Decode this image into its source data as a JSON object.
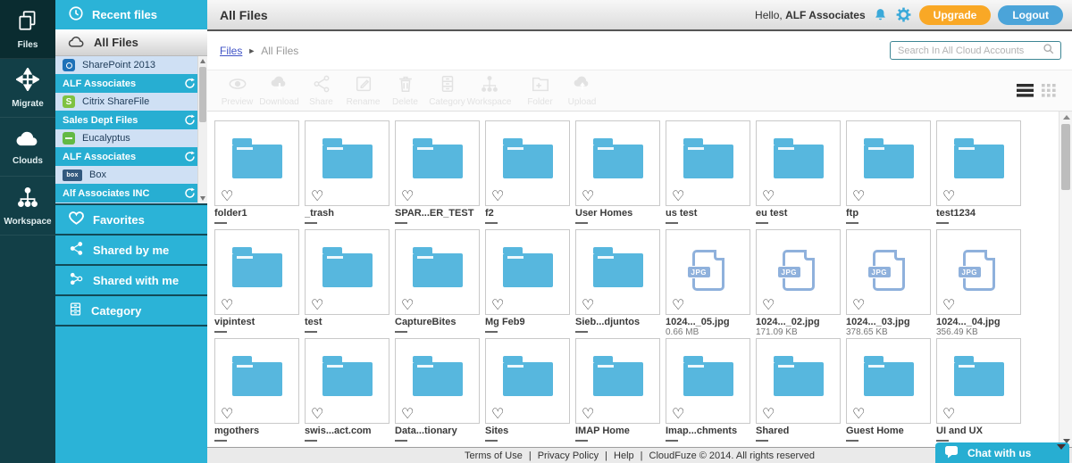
{
  "colors": {
    "teal": "#2bb3d7",
    "rail_dark": "#123f47",
    "rail_active": "#0a2c30",
    "account_row": "#27aed2",
    "provider_row": "#cfe0f4",
    "orange_button": "#f9a826",
    "blue_button": "#4ba4d9",
    "folder_icon": "#57b7de",
    "jpg_icon": "#8fb1dc",
    "header_icon_blue": "#3aa9d9"
  },
  "rail": {
    "items": [
      {
        "label": "Files",
        "icon": "files-icon",
        "active": true
      },
      {
        "label": "Migrate",
        "icon": "migrate-icon",
        "active": false
      },
      {
        "label": "Clouds",
        "icon": "clouds-icon",
        "active": false
      },
      {
        "label": "Workspace",
        "icon": "workspace-icon",
        "active": false
      }
    ]
  },
  "sidebar": {
    "recent_files": "Recent files",
    "all_files": "All Files",
    "accounts": [
      {
        "provider": "SharePoint 2013",
        "account": "ALF Associates"
      },
      {
        "provider": "Citrix ShareFile",
        "account": "Sales Dept Files"
      },
      {
        "provider": "Eucalyptus",
        "account": "ALF Associates"
      },
      {
        "provider": "Box",
        "account": "Alf Associates INC"
      }
    ],
    "favorites": "Favorites",
    "shared_by_me": "Shared by me",
    "shared_with_me": "Shared with me",
    "category": "Category"
  },
  "header": {
    "title": "All Files",
    "greeting": "Hello,",
    "username": "ALF Associates",
    "upgrade_label": "Upgrade",
    "logout_label": "Logout"
  },
  "breadcrumb": {
    "root": "Files",
    "current": "All Files"
  },
  "search": {
    "placeholder": "Search In All Cloud Accounts"
  },
  "toolbar": {
    "buttons": [
      {
        "label": "Preview"
      },
      {
        "label": "Download"
      },
      {
        "label": "Share"
      },
      {
        "label": "Rename"
      },
      {
        "label": "Delete"
      },
      {
        "label": "Category"
      },
      {
        "label": "Workspace"
      },
      {
        "label": "Folder"
      },
      {
        "label": "Upload"
      }
    ]
  },
  "grid": {
    "items": [
      {
        "name": "folder1",
        "type": "folder"
      },
      {
        "name": "_trash",
        "type": "folder"
      },
      {
        "name": "SPAR...ER_TEST",
        "type": "folder"
      },
      {
        "name": "f2",
        "type": "folder"
      },
      {
        "name": "User Homes",
        "type": "folder"
      },
      {
        "name": "us test",
        "type": "folder"
      },
      {
        "name": "eu test",
        "type": "folder"
      },
      {
        "name": "ftp",
        "type": "folder"
      },
      {
        "name": "test1234",
        "type": "folder"
      },
      {
        "name": "vipintest",
        "type": "folder"
      },
      {
        "name": "test",
        "type": "folder"
      },
      {
        "name": "CaptureBites",
        "type": "folder"
      },
      {
        "name": "Mg Feb9",
        "type": "folder"
      },
      {
        "name": "Sieb...djuntos",
        "type": "folder"
      },
      {
        "name": "1024..._05.jpg",
        "type": "jpg",
        "size": "0.66 MB"
      },
      {
        "name": "1024..._02.jpg",
        "type": "jpg",
        "size": "171.09 KB"
      },
      {
        "name": "1024..._03.jpg",
        "type": "jpg",
        "size": "378.65 KB"
      },
      {
        "name": "1024..._04.jpg",
        "type": "jpg",
        "size": "356.49 KB"
      },
      {
        "name": "mgothers",
        "type": "folder"
      },
      {
        "name": "swis...act.com",
        "type": "folder"
      },
      {
        "name": "Data...tionary",
        "type": "folder"
      },
      {
        "name": "Sites",
        "type": "folder"
      },
      {
        "name": "IMAP Home",
        "type": "folder"
      },
      {
        "name": "Imap...chments",
        "type": "folder"
      },
      {
        "name": "Shared",
        "type": "folder"
      },
      {
        "name": "Guest Home",
        "type": "folder"
      },
      {
        "name": "UI and UX",
        "type": "folder"
      }
    ]
  },
  "footer": {
    "links": [
      "Terms of Use",
      "Privacy Policy",
      "Help"
    ],
    "separator": "|",
    "copyright": "CloudFuze © 2014. All rights reserved"
  },
  "chat": {
    "label": "Chat with us"
  },
  "icons": {
    "heart": "♡",
    "jpg_label": "JPG",
    "box_logo": "box",
    "sharefile_logo": "S",
    "breadcrumb_arrow": "►"
  }
}
